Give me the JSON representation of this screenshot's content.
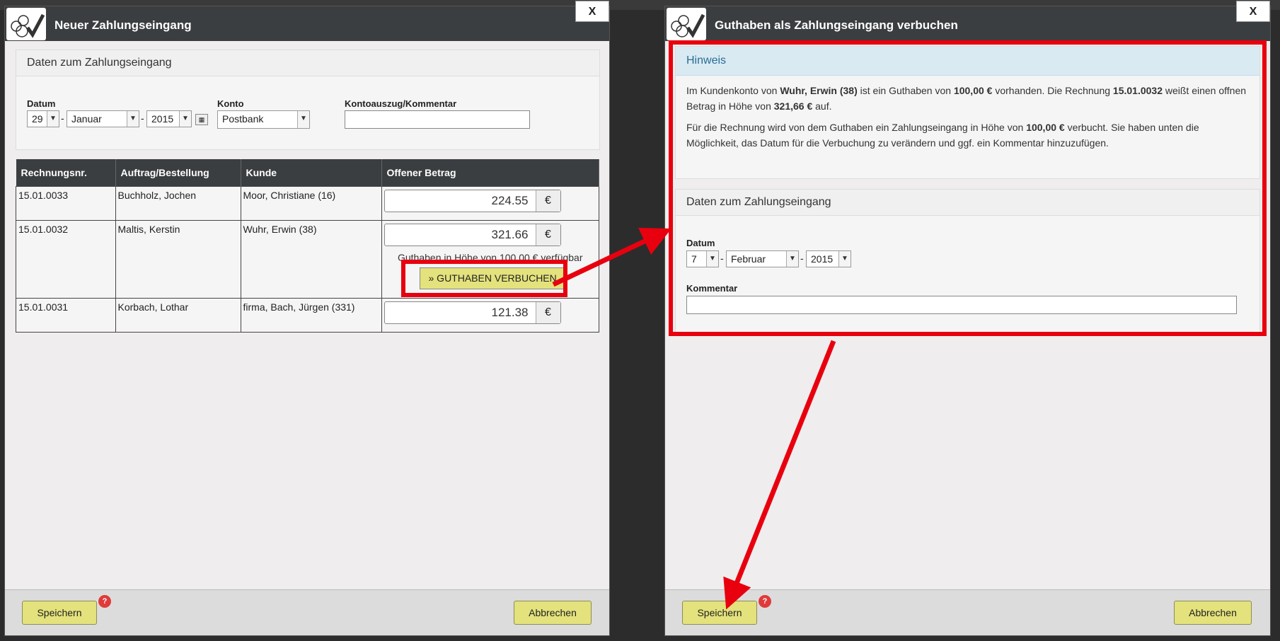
{
  "dialog_left": {
    "title": "Neuer Zahlungseingang",
    "close_label": "X",
    "panel_title": "Daten zum Zahlungseingang",
    "labels": {
      "datum": "Datum",
      "konto": "Konto",
      "kommentar": "Kontoauszug/Kommentar"
    },
    "date": {
      "day": "29",
      "month": "Januar",
      "year": "2015"
    },
    "konto": "Postbank",
    "kommentar_value": "",
    "table": {
      "headers": [
        "Rechnungsnr.",
        "Auftrag/Bestellung",
        "Kunde",
        "Offener Betrag"
      ],
      "rows": [
        {
          "nr": "15.01.0033",
          "auftrag": "Buchholz, Jochen",
          "kunde": "Moor, Christiane (16)",
          "betrag": "224.55"
        },
        {
          "nr": "15.01.0032",
          "auftrag": "Maltis, Kerstin",
          "kunde": "Wuhr, Erwin (38)",
          "betrag": "321.66"
        },
        {
          "nr": "15.01.0031",
          "auftrag": "Korbach, Lothar",
          "kunde": "firma, Bach, Jürgen (331)",
          "betrag": "121.38"
        }
      ],
      "currency": "€",
      "credit_note": "Guthaben in Höhe von 100,00 € verfügbar",
      "credit_button": "» GUTHABEN VERBUCHEN"
    },
    "footer": {
      "save": "Speichern",
      "cancel": "Abbrechen",
      "badge": "?"
    }
  },
  "dialog_right": {
    "title": "Guthaben als Zahlungseingang verbuchen",
    "close_label": "X",
    "notice_title": "Hinweis",
    "notice_p1": {
      "a": "Im Kundenkonto von ",
      "b": "Wuhr, Erwin (38)",
      "c": " ist ein Guthaben von ",
      "d": "100,00 €",
      "e": " vorhanden. Die Rechnung ",
      "f": "15.01.0032",
      "g": " weißt einen offnen Betrag in Höhe von ",
      "h": "321,66 €",
      "i": " auf."
    },
    "notice_p2": {
      "a": "Für die Rechnung wird von dem Guthaben ein Zahlungseingang in Höhe von ",
      "b": "100,00 €",
      "c": " verbucht. Sie haben unten die Möglichkeit, das Datum für die Verbuchung zu verändern und ggf. ein Kommentar hinzuzufügen."
    },
    "panel_title": "Daten zum Zahlungseingang",
    "labels": {
      "datum": "Datum",
      "kommentar": "Kommentar"
    },
    "date": {
      "day": "7",
      "month": "Februar",
      "year": "2015"
    },
    "kommentar_value": "",
    "footer": {
      "save": "Speichern",
      "cancel": "Abbrechen",
      "badge": "?"
    }
  },
  "colors": {
    "annotation_red": "#e8000f",
    "button_yellow": "#e3e27c",
    "titlebar": "#3b3e40",
    "notice_blue": "#d9eaf3"
  }
}
